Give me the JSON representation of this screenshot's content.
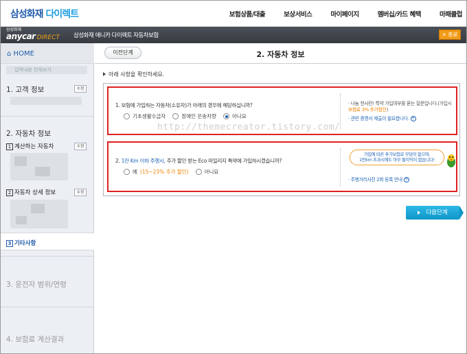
{
  "topnav": {
    "brand_main": "삼성화재",
    "brand_sub": "다이렉트",
    "menu": [
      "보험상품/대출",
      "보상서비스",
      "마이페이지",
      "멤버십/카드 혜택",
      "마패클럽"
    ]
  },
  "subbar": {
    "logo_small": "삼성화재",
    "logo_main": "anycar",
    "logo_direct": "DIRECT",
    "title": "삼성화재 애니카 다이렉트 자동차보험",
    "close_label": "✕ 종료"
  },
  "sidebar": {
    "home": "HOME",
    "hint": "입력내용 전체보기",
    "step1": "1. 고객 정보",
    "step2": "2. 자동차 정보",
    "step2_sub1_num": "1",
    "step2_sub1": "계산하는 자동차",
    "step2_sub2_num": "2",
    "step2_sub2": "자동차 상세 정보",
    "step2_sub3_num": "3",
    "step2_sub3": "기타사항",
    "step3": "3. 운전자 범위/연령",
    "step4": "4. 보험료 계산결과",
    "edit_label": "수정"
  },
  "main": {
    "prev_label": "이전단계",
    "title": "2. 자동차 정보",
    "notice": "아래 사항을 확인하세요.",
    "q1": {
      "text": "1. 보험에 가입하는 자동차(소유자)가 아래의 경우에 해당하십니까?",
      "options": [
        "기초생활수급자",
        "장애인 운송차량",
        "아니요"
      ],
      "selected": 2,
      "info_line1": "· 나눔 천사란! 특약 가입여부를 묻는 질문입니다.(가입시",
      "info_line2_orange": "보험료 3% 추가할인",
      "info_line2_tail": ")",
      "info_link": "· 관련 증명서 제출이 필요합니다."
    },
    "q2": {
      "text_prefix": "2. ",
      "text_blue": "1만 Km 이하 주행시,",
      "text_rest": " 추가 할인 받는 Eco 마일리지 특약에 가입하시겠습니까?",
      "opt_yes": "예",
      "opt_yes_note": "(15~23% 추가 할인)",
      "opt_no": "아니요",
      "bubble_line1": "가입에 따른 추가보험료 부담이 없으며,",
      "bubble_line2": "1만km 초과시에도 아무 불이익이 없습니다!",
      "info_link": "· 주행거리사진 2회 등록 안내"
    },
    "next_label": "다음단계",
    "watermark": "http://themecreator.tistory.com/"
  },
  "colors": {
    "brand_blue": "#1f5aa8",
    "accent_orange": "#f08300",
    "highlight_red": "#e02020",
    "next_button": "#1096c9"
  }
}
